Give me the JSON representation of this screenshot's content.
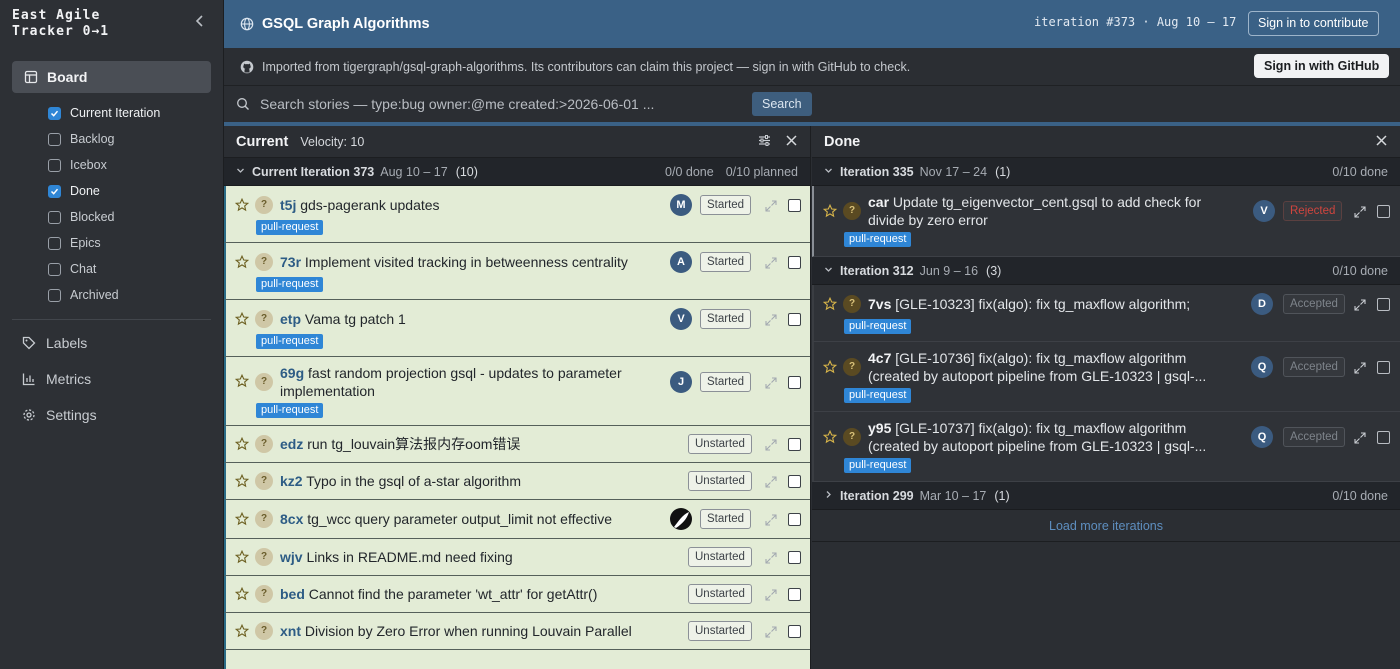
{
  "sidebar": {
    "brand_line1": "East Agile",
    "brand_line2": "Tracker 0→1",
    "board_label": "Board",
    "filters": [
      {
        "label": "Current Iteration",
        "checked": true
      },
      {
        "label": "Backlog",
        "checked": false
      },
      {
        "label": "Icebox",
        "checked": false
      },
      {
        "label": "Done",
        "checked": true
      },
      {
        "label": "Blocked",
        "checked": false
      },
      {
        "label": "Epics",
        "checked": false
      },
      {
        "label": "Chat",
        "checked": false
      },
      {
        "label": "Archived",
        "checked": false
      }
    ],
    "labels": "Labels",
    "metrics": "Metrics",
    "settings": "Settings"
  },
  "header": {
    "title": "GSQL Graph Algorithms",
    "iteration": "iteration #373 · Aug 10 – 17",
    "sign_in": "Sign in to contribute"
  },
  "import": {
    "message": "Imported from tigergraph/gsql-graph-algorithms. Its contributors can claim this project — sign in with GitHub to check.",
    "github_button": "Sign in with GitHub"
  },
  "search": {
    "placeholder": "Search stories — type:bug owner:@me created:>2026-06-01 ...",
    "button": "Search"
  },
  "current": {
    "title": "Current",
    "velocity": "Velocity: 10",
    "iteration": {
      "name": "Current Iteration 373",
      "dates": "Aug 10 – 17",
      "count": "(10)",
      "done": "0/0 done",
      "planned": "0/10 planned"
    },
    "stories": [
      {
        "id": "t5j",
        "title": "gds-pagerank updates",
        "tag": "pull-request",
        "avatar": "M",
        "state": "Started"
      },
      {
        "id": "73r",
        "title": "Implement visited tracking in betweenness centrality",
        "tag": "pull-request",
        "avatar": "A",
        "state": "Started"
      },
      {
        "id": "etp",
        "title": "Vama tg patch 1",
        "tag": "pull-request",
        "avatar": "V",
        "state": "Started"
      },
      {
        "id": "69g",
        "title": "fast random projection gsql - updates to parameter implementation",
        "tag": "pull-request",
        "avatar": "J",
        "state": "Started"
      },
      {
        "id": "edz",
        "title": "run tg_louvain算法报内存oom错误",
        "state": "Unstarted"
      },
      {
        "id": "kz2",
        "title": "Typo in the gsql of a-star algorithm",
        "state": "Unstarted"
      },
      {
        "id": "8cx",
        "title": "tg_wcc query parameter output_limit not effective",
        "state": "Started"
      },
      {
        "id": "wjv",
        "title": "Links in README.md need fixing",
        "state": "Unstarted"
      },
      {
        "id": "bed",
        "title": "Cannot find the parameter 'wt_attr' for getAttr()",
        "state": "Unstarted"
      },
      {
        "id": "xnt",
        "title": "Division by Zero Error when running Louvain Parallel",
        "state": "Unstarted"
      }
    ]
  },
  "done": {
    "title": "Done",
    "it335": {
      "name": "Iteration 335",
      "dates": "Nov 17 – 24",
      "count": "(1)",
      "done": "0/10 done"
    },
    "it312": {
      "name": "Iteration 312",
      "dates": "Jun 9 – 16",
      "count": "(3)",
      "done": "0/10 done"
    },
    "it299": {
      "name": "Iteration 299",
      "dates": "Mar 10 – 17",
      "count": "(1)",
      "done": "0/10 done"
    },
    "stories": [
      {
        "id": "car",
        "title": "Update tg_eigenvector_cent.gsql to add check for",
        "title2": "divide by zero error",
        "tag": "pull-request",
        "avatar": "V",
        "state": "Rejected"
      },
      {
        "id": "7vs",
        "title": "[GLE-10323] fix(algo): fix tg_maxflow algorithm;",
        "tag": "pull-request",
        "avatar": "D",
        "state": "Accepted"
      },
      {
        "id": "4c7",
        "title": "[GLE-10736] fix(algo): fix tg_maxflow algorithm",
        "title2": "(created by autoport pipeline from GLE-10323 | gsql-...",
        "tag": "pull-request",
        "avatar": "Q",
        "state": "Accepted"
      },
      {
        "id": "y95",
        "title": "[GLE-10737] fix(algo): fix tg_maxflow algorithm",
        "title2": "(created by autoport pipeline from GLE-10323 | gsql-...",
        "tag": "pull-request",
        "avatar": "Q",
        "state": "Accepted"
      }
    ],
    "load_more": "Load more iterations"
  }
}
